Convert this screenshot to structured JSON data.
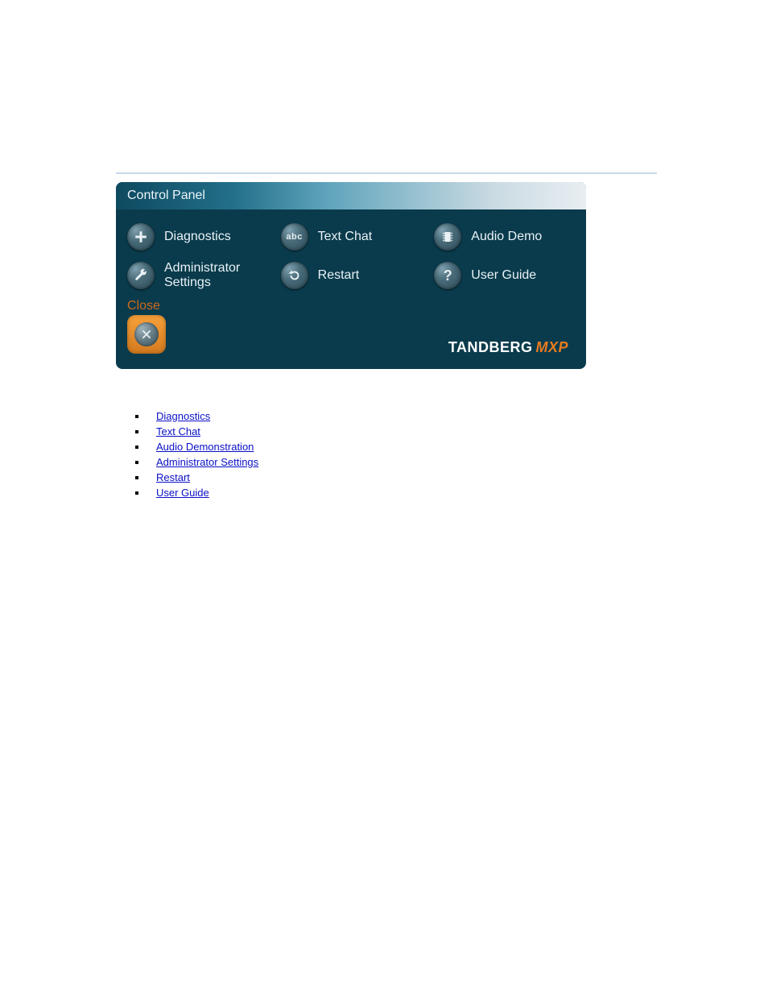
{
  "panel": {
    "title": "Control Panel",
    "items": [
      {
        "label": "Diagnostics",
        "icon": "plus"
      },
      {
        "label": "Text Chat",
        "icon": "abc"
      },
      {
        "label": "Audio Demo",
        "icon": "film"
      },
      {
        "label": "Administrator Settings",
        "icon": "wrench"
      },
      {
        "label": "Restart",
        "icon": "restart"
      },
      {
        "label": "User Guide",
        "icon": "question"
      }
    ],
    "close_label": "Close",
    "brand": {
      "name": "TANDBERG",
      "suffix": "MXP"
    }
  },
  "links": [
    "Diagnostics",
    "Text Chat",
    "Audio Demonstration",
    "Administrator Settings",
    "Restart",
    "User Guide"
  ]
}
